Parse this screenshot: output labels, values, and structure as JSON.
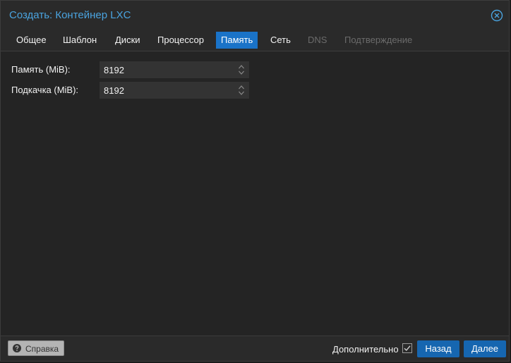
{
  "window": {
    "title": "Создать: Контейнер LXC",
    "accent_color": "#4aa3df",
    "close_icon": "close-circle-icon"
  },
  "tabs": [
    {
      "label": "Общее",
      "state": "normal"
    },
    {
      "label": "Шаблон",
      "state": "normal"
    },
    {
      "label": "Диски",
      "state": "normal"
    },
    {
      "label": "Процессор",
      "state": "normal"
    },
    {
      "label": "Память",
      "state": "active"
    },
    {
      "label": "Сеть",
      "state": "normal"
    },
    {
      "label": "DNS",
      "state": "disabled"
    },
    {
      "label": "Подтверждение",
      "state": "disabled"
    }
  ],
  "form": {
    "memory": {
      "label": "Память (MiB):",
      "value": "8192"
    },
    "swap": {
      "label": "Подкачка (MiB):",
      "value": "8192"
    }
  },
  "footer": {
    "help_label": "Справка",
    "help_icon": "question-circle-icon",
    "advanced_label": "Дополнительно",
    "advanced_checked": true,
    "back_label": "Назад",
    "next_label": "Далее"
  }
}
